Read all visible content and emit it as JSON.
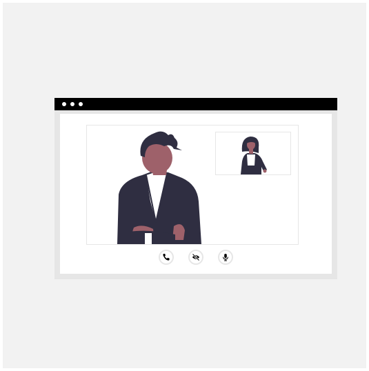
{
  "app": {
    "type": "video-call-window"
  },
  "colors": {
    "page_bg": "#f2f2f2",
    "window_frame": "#e6e6e6",
    "titlebar": "#000000",
    "suit": "#2f2e41",
    "skin": "#9e616a",
    "shirt": "#ffffff"
  },
  "window": {
    "titlebar_dots": [
      "close",
      "minimize",
      "maximize"
    ]
  },
  "main_video": {
    "participant_icon": "man-in-suit-illustration"
  },
  "pip_video": {
    "participant_icon": "woman-in-suit-illustration"
  },
  "controls": [
    {
      "icon": "phone-icon",
      "action": "end-call"
    },
    {
      "icon": "eye-slash-icon",
      "action": "toggle-camera"
    },
    {
      "icon": "microphone-icon",
      "action": "toggle-mic"
    }
  ]
}
